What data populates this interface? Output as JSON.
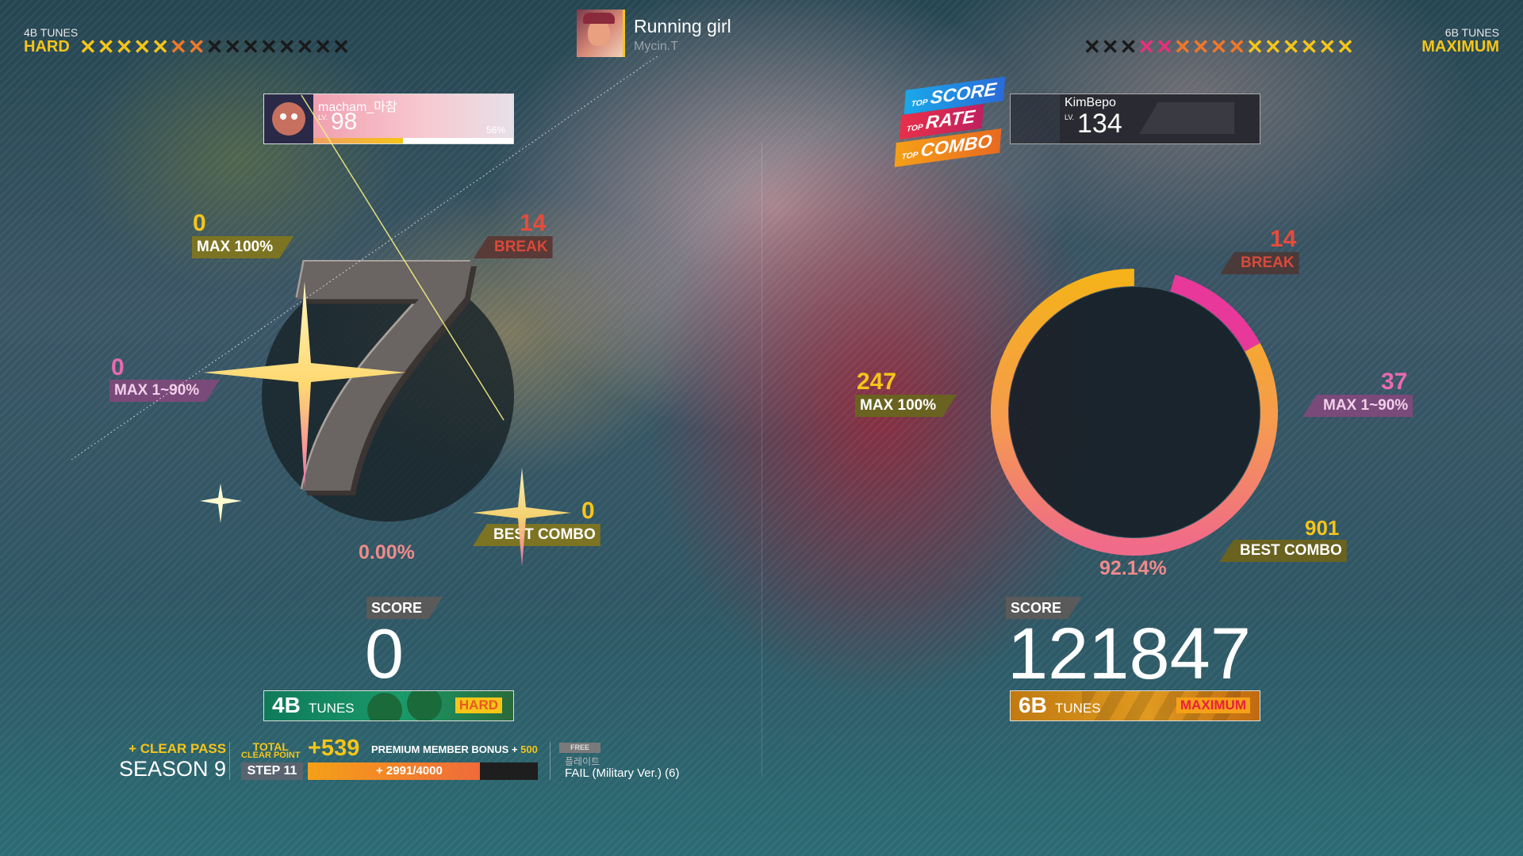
{
  "header": {
    "left": {
      "tunes": "4B TUNES",
      "difficulty": "HARD",
      "level_lit": 7,
      "level_max": 15
    },
    "right": {
      "tunes": "6B TUNES",
      "difficulty": "MAXIMUM",
      "level_lit": 12,
      "level_max": 15
    },
    "song": {
      "title": "Running girl",
      "artist": "Mycin.T"
    }
  },
  "left_player": {
    "name": "macham_마참",
    "lv_label": "LV.",
    "level": "98",
    "progress": "56%",
    "max100": "0",
    "max100_label": "MAX 100%",
    "break": "14",
    "break_label": "BREAK",
    "max1_90": "0",
    "max1_90_label": "MAX 1~90%",
    "best_combo": "0",
    "best_combo_label": "BEST COMBO",
    "rate": "0.00%",
    "rank_glyph": "7",
    "score_label": "SCORE",
    "score": "0",
    "mode_num": "4B",
    "mode_word": "TUNES",
    "mode_diff": "HARD"
  },
  "right_player": {
    "name": "KimBepo",
    "lv_label": "LV.",
    "level": "134",
    "top_badges": [
      {
        "small": "TOP",
        "big": "SCORE"
      },
      {
        "small": "TOP",
        "big": "RATE"
      },
      {
        "small": "TOP",
        "big": "COMBO"
      }
    ],
    "break": "14",
    "break_label": "BREAK",
    "max100": "247",
    "max100_label": "MAX 100%",
    "max1_90": "37",
    "max1_90_label": "MAX 1~90%",
    "best_combo": "901",
    "best_combo_label": "BEST COMBO",
    "rate": "92.14%",
    "rate_fraction": 0.9214,
    "break_fraction_start": 0.046,
    "break_fraction_end": 0.17,
    "score_label": "SCORE",
    "score": "121847",
    "mode_num": "6B",
    "mode_word": "TUNES",
    "mode_diff": "MAXIMUM"
  },
  "footer": {
    "clear_pass": "+ CLEAR PASS",
    "season": "SEASON 9",
    "total_label": "TOTAL",
    "clear_point_label": "CLEAR POINT",
    "points": "+539",
    "bonus_label": "PREMIUM MEMBER BONUS +",
    "bonus_value": "500",
    "step": "STEP 11",
    "step_progress": "+ 2991/4000",
    "step_fraction": 0.7478,
    "free_badge": "FREE",
    "play_label": "플레이트",
    "play_name": "FAIL (Military Ver.) (6)"
  },
  "colors": {
    "lit_star": "#f5c518",
    "orange_star": "#f07828",
    "pink_star": "#e8307a",
    "dark_star": "#1a1a1a",
    "yellow": "#f5c518",
    "red": "#e84a3a",
    "pink": "#e86ab0",
    "ring_pink": "#e8389a"
  }
}
